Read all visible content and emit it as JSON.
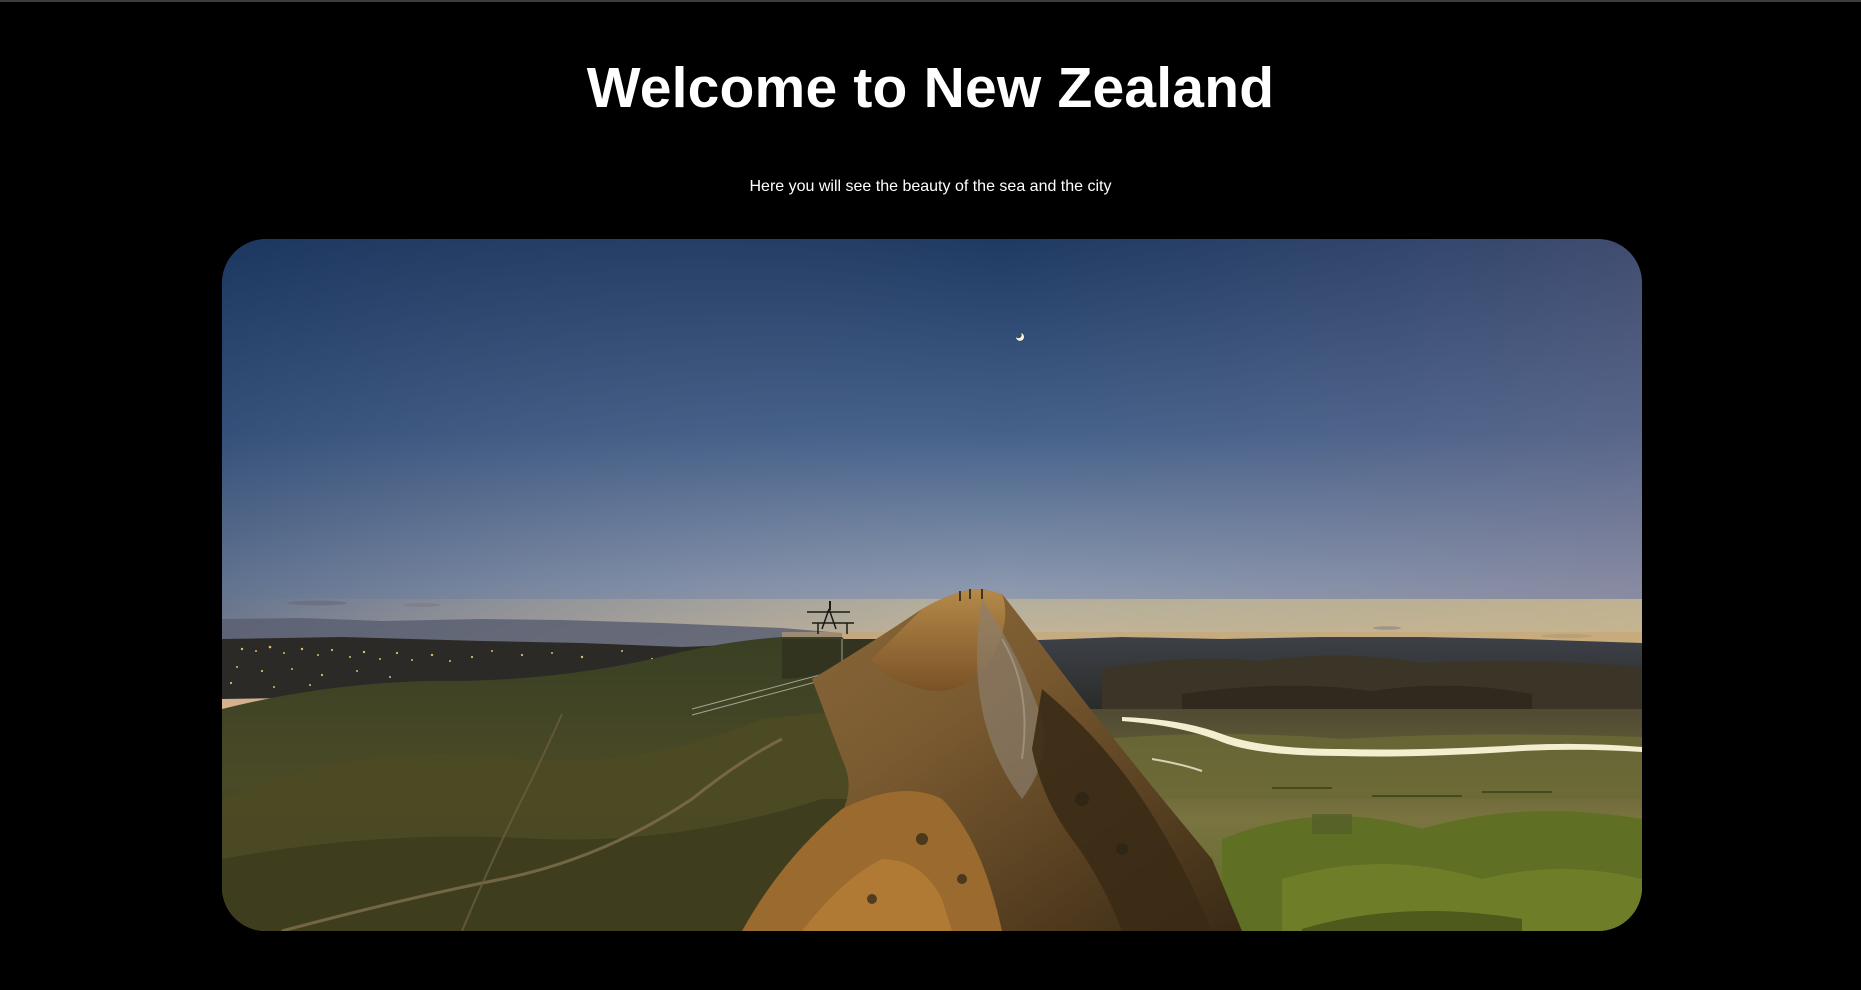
{
  "header": {
    "title": "Welcome to New Zealand",
    "subtitle": "Here you will see the beauty of the sea and the city"
  },
  "hero": {
    "image_icon": "landscape-photo-icon"
  },
  "colors": {
    "background": "#000000",
    "text": "#ffffff",
    "top_rule": "#3c3c3c"
  }
}
